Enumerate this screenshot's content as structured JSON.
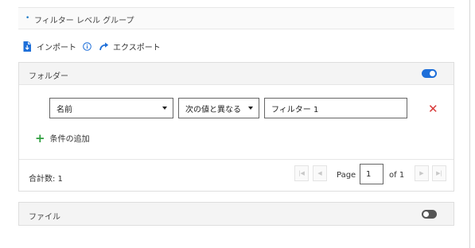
{
  "group_header": {
    "title": "フィルター レベル グループ"
  },
  "toolbar": {
    "import_label": "インポート",
    "export_label": "エクスポート"
  },
  "folder_panel": {
    "title": "フォルダー",
    "enabled": true,
    "condition": {
      "field": "名前",
      "operator": "次の値と異なる",
      "value": "フィルター 1"
    },
    "add_condition_label": "条件の追加",
    "total_label": "合計数: 1",
    "pagination": {
      "page_label": "Page",
      "page_value": "1",
      "of_label": "of 1"
    }
  },
  "file_panel": {
    "title": "ファイル",
    "enabled": false
  },
  "colors": {
    "accent": "#1e6fd9",
    "remove": "#d83a3a",
    "add": "#2e9e3e"
  }
}
